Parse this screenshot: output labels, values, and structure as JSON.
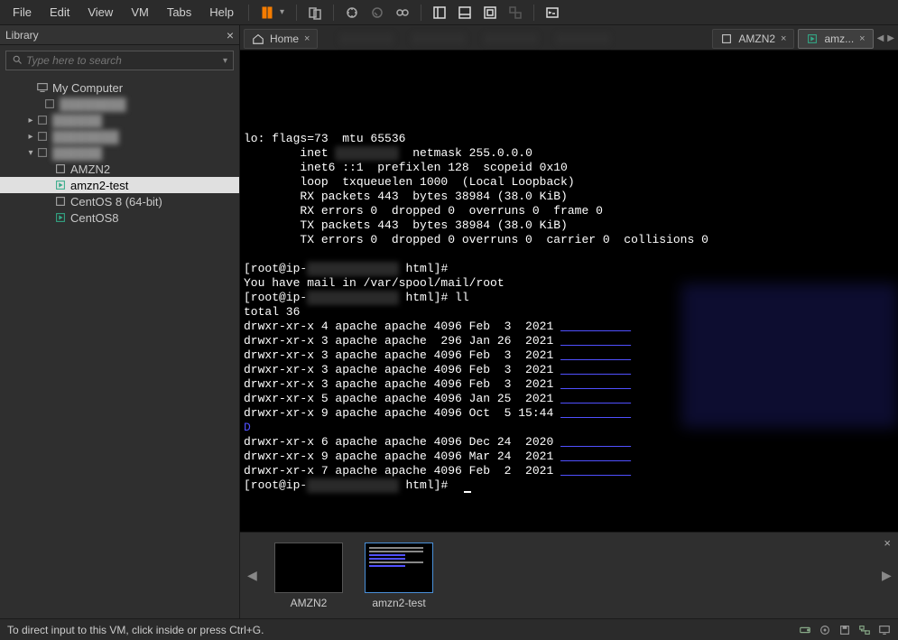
{
  "menu": {
    "items": [
      "File",
      "Edit",
      "View",
      "VM",
      "Tabs",
      "Help"
    ]
  },
  "sidebar": {
    "title": "Library",
    "search_placeholder": "Type here to search",
    "root": "My Computer",
    "items": [
      {
        "label": "AMZN2",
        "state": "off"
      },
      {
        "label": "amzn2-test",
        "state": "on",
        "selected": true
      },
      {
        "label": "CentOS 8 (64-bit)",
        "state": "off"
      },
      {
        "label": "CentOS8",
        "state": "on"
      }
    ]
  },
  "tabs": {
    "home": "Home",
    "t1": "AMZN2",
    "t2": "amz..."
  },
  "terminal": {
    "lines": [
      "",
      "lo: flags=73<UP,LOOPBACK,RUNNING>  mtu 65536",
      "        inet           netmask 255.0.0.0",
      "        inet6 ::1  prefixlen 128  scopeid 0x10<host>",
      "        loop  txqueuelen 1000  (Local Loopback)",
      "        RX packets 443  bytes 38984 (38.0 KiB)",
      "        RX errors 0  dropped 0  overruns 0  frame 0",
      "        TX packets 443  bytes 38984 (38.0 KiB)",
      "        TX errors 0  dropped 0 overruns 0  carrier 0  collisions 0",
      "",
      "[root@ip-              html]#",
      "You have mail in /var/spool/mail/root",
      "[root@ip-              html]# ll",
      "total 36",
      "drwxr-xr-x 4 apache apache 4096 Feb  3  2021 ",
      "drwxr-xr-x 3 apache apache  296 Jan 26  2021 ",
      "drwxr-xr-x 3 apache apache 4096 Feb  3  2021 ",
      "drwxr-xr-x 3 apache apache 4096 Feb  3  2021 ",
      "drwxr-xr-x 3 apache apache 4096 Feb  3  2021 ",
      "drwxr-xr-x 5 apache apache 4096 Jan 25  2021 ",
      "drwxr-xr-x 9 apache apache 4096 Oct  5 15:44 ",
      "D",
      "drwxr-xr-x 6 apache apache 4096 Dec 24  2020 ",
      "drwxr-xr-x 9 apache apache 4096 Mar 24  2021 ",
      "drwxr-xr-x 7 apache apache 4096 Feb  2  2021 ",
      "[root@ip-              html]# "
    ]
  },
  "thumbs": {
    "t1": "AMZN2",
    "t2": "amzn2-test"
  },
  "status": {
    "hint": "To direct input to this VM, click inside or press Ctrl+G."
  }
}
